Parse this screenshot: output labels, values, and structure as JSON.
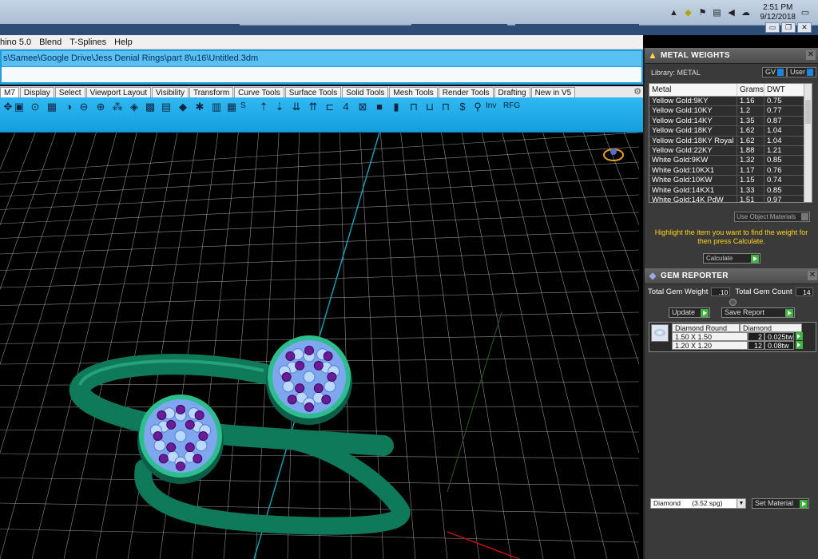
{
  "taskbar": {
    "clock_time": "2:51 PM",
    "clock_date": "9/12/2018",
    "tray_icons": [
      "chevron-up-icon",
      "shield-icon",
      "flag-icon",
      "network-icon",
      "volume-icon",
      "cloud-icon",
      "display-icon"
    ]
  },
  "window": {
    "min_label": "▭",
    "restore_label": "❐",
    "close_label": "✕"
  },
  "menu": {
    "items": [
      "hino 5.0",
      "Blend",
      "T-Splines",
      "Help"
    ]
  },
  "command": {
    "path": "s\\Samee\\Google Drive\\Jess Denial Rings\\part 8\\u16\\Untitled.3dm"
  },
  "tabs": [
    "M7",
    "Display",
    "Select",
    "Viewport Layout",
    "Visibility",
    "Transform",
    "Curve Tools",
    "Surface Tools",
    "Solid Tools",
    "Mesh Tools",
    "Render Tools",
    "Drafting",
    "New in V5"
  ],
  "toolbar": {
    "labels": [
      "S",
      "Inv",
      "RFG"
    ]
  },
  "metal_weights": {
    "title": "METAL WEIGHTS",
    "library_label": "Library: METAL",
    "gv_label": "GV",
    "user_label": "User",
    "columns": [
      "Metal",
      "Grams",
      "DWT"
    ],
    "rows": [
      {
        "metal": "Yellow Gold:9KY",
        "grams": "1.16",
        "dwt": "0.75"
      },
      {
        "metal": "Yellow Gold:10KY",
        "grams": "1.2",
        "dwt": "0.77"
      },
      {
        "metal": "Yellow Gold:14KY",
        "grams": "1.35",
        "dwt": "0.87"
      },
      {
        "metal": "Yellow Gold:18KY",
        "grams": "1.62",
        "dwt": "1.04"
      },
      {
        "metal": "Yellow Gold:18KY Royal",
        "grams": "1.62",
        "dwt": "1.04"
      },
      {
        "metal": "Yellow Gold:22KY",
        "grams": "1.88",
        "dwt": "1.21"
      },
      {
        "metal": "White Gold:9KW",
        "grams": "1.32",
        "dwt": "0.85"
      },
      {
        "metal": "White Gold:10KX1",
        "grams": "1.17",
        "dwt": "0.76"
      },
      {
        "metal": "White Gold:10KW",
        "grams": "1.15",
        "dwt": "0.74"
      },
      {
        "metal": "White Gold:14KX1",
        "grams": "1.33",
        "dwt": "0.85"
      },
      {
        "metal": "White Gold:14K PdW",
        "grams": "1.51",
        "dwt": "0.97"
      }
    ],
    "use_object_label": "Use Object Materials",
    "hint": "Highlight the item you want to find the weight for then press Calculate.",
    "calculate_label": "Calculate"
  },
  "gem_reporter": {
    "title": "GEM REPORTER",
    "total_weight_label": "Total Gem Weight",
    "total_weight_value": ".10",
    "total_count_label": "Total Gem Count",
    "total_count_value": "14",
    "update_label": "Update",
    "save_label": "Save Report",
    "table_header": [
      "Diamond Round",
      "Diamond"
    ],
    "rows": [
      {
        "size": "1.50 X 1.50",
        "count": "2",
        "weight": "0.025tw"
      },
      {
        "size": "1.20 X 1.20",
        "count": "12",
        "weight": "0.08tw"
      }
    ],
    "material_select": "Diamond      (3.52 spg)",
    "set_material_label": "Set Material"
  },
  "colors": {
    "toolbar_blue": "#1aa9e8",
    "ring_green": "#0f7a5a",
    "gem_blue": "#b8d8ff",
    "gem_purple": "#6a1b9a",
    "hint_yellow": "#ffd31a"
  }
}
